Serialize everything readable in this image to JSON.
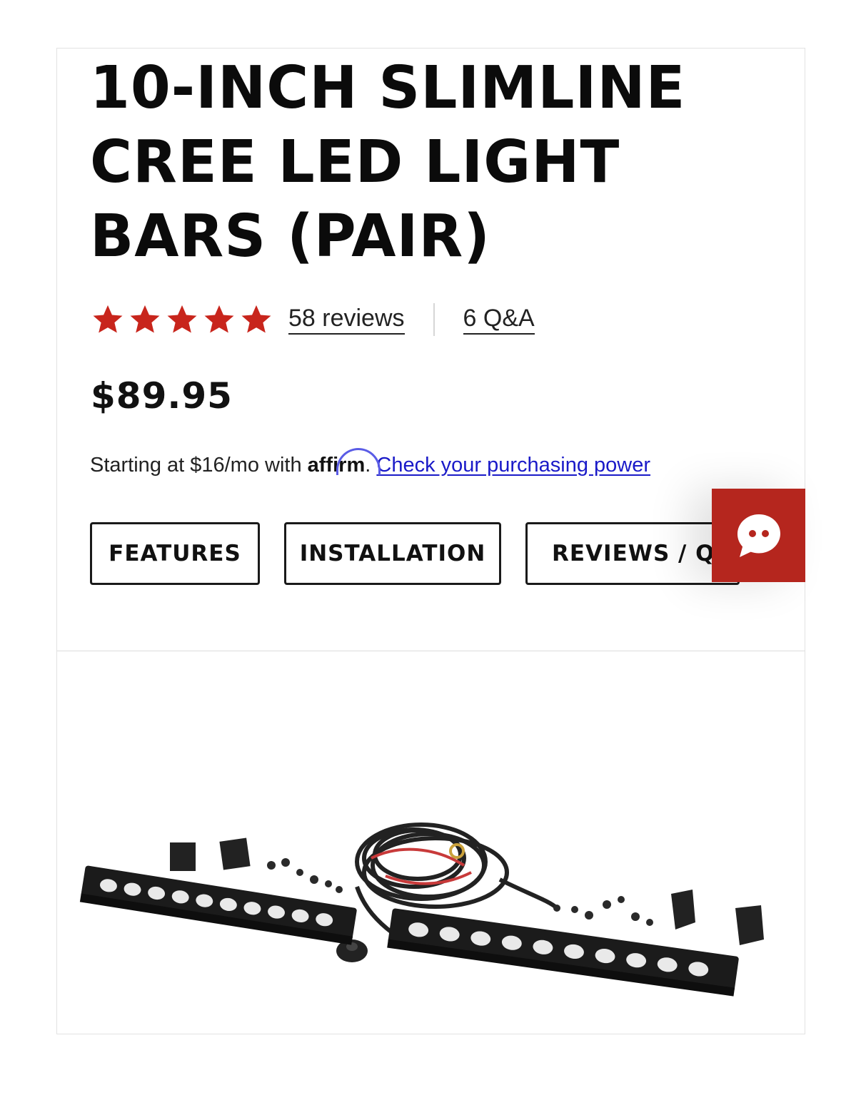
{
  "product": {
    "title": "10-INCH SLIMLINE CREE LED LIGHT BARS (PAIR)",
    "rating": {
      "stars": 5,
      "max_stars": 5,
      "star_color": "#c8251c"
    },
    "reviews_label": "58 reviews",
    "qa_label": "6 Q&A",
    "price": "$89.95"
  },
  "financing": {
    "prefix": "Starting at $16/mo with",
    "brand": "affirm",
    "separator": ".",
    "link_label": "Check your purchasing power"
  },
  "tabs": [
    {
      "label": "FEATURES"
    },
    {
      "label": "INSTALLATION"
    },
    {
      "label": "REVIEWS / QA"
    }
  ],
  "chat": {
    "icon": "chat-bubble-icon",
    "color": "#b5261e"
  },
  "gallery": {
    "image": "led-light-bar-kit-image"
  }
}
